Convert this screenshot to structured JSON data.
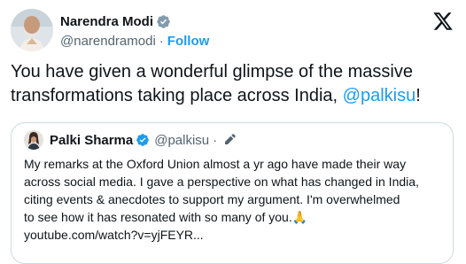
{
  "tweet": {
    "author": {
      "name": "Narendra Modi",
      "handle": "@narendramodi",
      "separator": "·",
      "follow_label": "Follow"
    },
    "text_main": "You have given a wonderful glimpse of the massive transformations taking place across India, ",
    "mention": "@palkisu",
    "text_end": "!",
    "quote": {
      "name": "Palki Sharma",
      "handle": "@palkisu",
      "separator": "·",
      "line1": "My remarks at the Oxford Union almost a yr ago have made their way",
      "line2": "across social media. I gave a perspective on what has changed in India,",
      "line3": "citing events & anecdotes to support my argument. I'm overwhelmed",
      "line4": "to see how it has resonated with so many of you.🙏",
      "link": "youtube.com/watch?v=yjFEYR..."
    }
  },
  "icons": {
    "verified": "verified-badge-icon",
    "logo": "x-logo-icon",
    "edit": "edited-pencil-icon"
  },
  "colors": {
    "accent": "#1d9bf0",
    "text": "#0f1419",
    "secondary": "#536471",
    "border": "#cfd9de"
  }
}
